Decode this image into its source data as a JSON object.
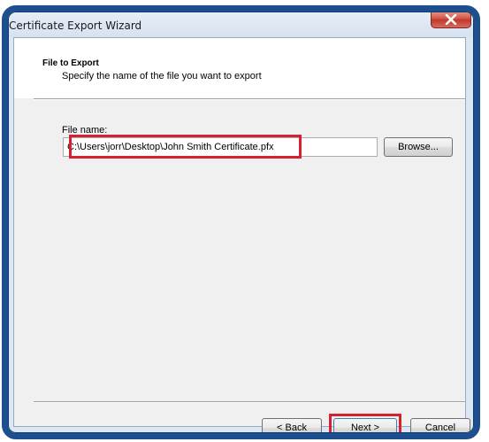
{
  "window": {
    "title": "Certificate Export Wizard"
  },
  "header": {
    "title": "File to Export",
    "subtitle": "Specify the name of the file you want to export"
  },
  "form": {
    "file_label": "File name:",
    "file_value": "C:\\Users\\jorr\\Desktop\\John Smith Certificate.pfx",
    "browse_label": "Browse..."
  },
  "footer": {
    "back_label": "< Back",
    "next_label": "Next >",
    "cancel_label": "Cancel"
  },
  "colors": {
    "highlight_red": "#d6212f",
    "frame_blue": "#1d4f8e",
    "close_red": "#c0392b"
  },
  "icons": {
    "close": "close-icon"
  }
}
